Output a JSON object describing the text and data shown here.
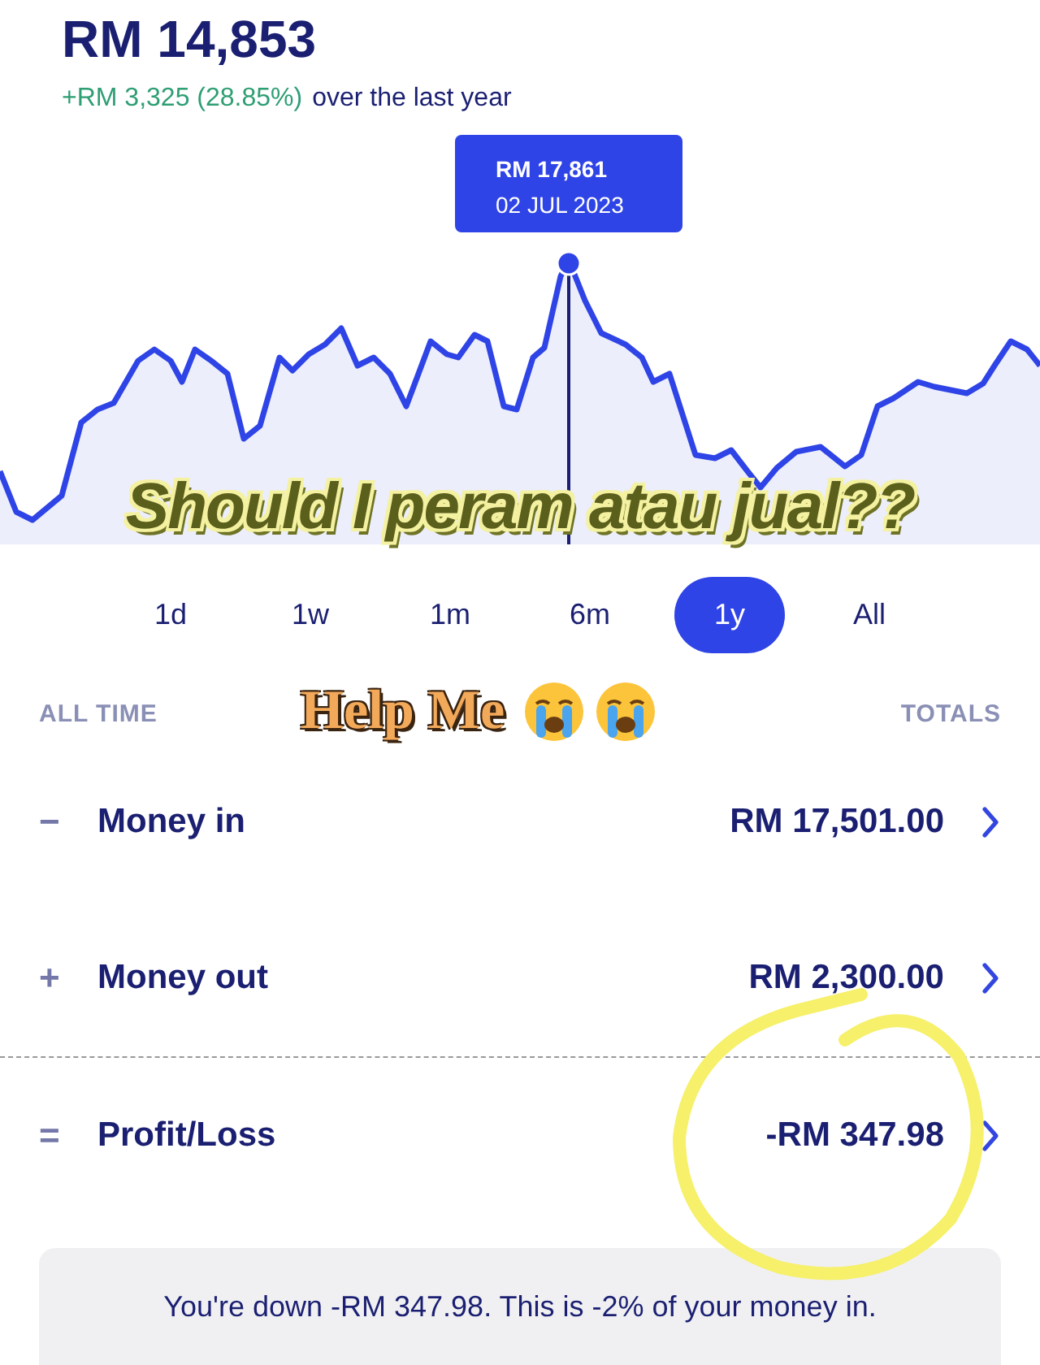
{
  "balance": {
    "amount": "RM 14,853",
    "change": "+RM 3,325 (28.85%)",
    "period": "over the last year"
  },
  "chart": {
    "tooltip": {
      "value": "RM 17,861",
      "date": "02 JUL 2023"
    }
  },
  "ranges": [
    {
      "label": "1d",
      "selected": false
    },
    {
      "label": "1w",
      "selected": false
    },
    {
      "label": "1m",
      "selected": false
    },
    {
      "label": "6m",
      "selected": false
    },
    {
      "label": "1y",
      "selected": true
    },
    {
      "label": "All",
      "selected": false
    }
  ],
  "summary": {
    "left_label": "ALL TIME",
    "right_label": "TOTALS",
    "rows": [
      {
        "kind": "entry",
        "sign": "−",
        "label": "Money in",
        "value": "RM 17,501.00"
      },
      {
        "kind": "entry",
        "sign": "+",
        "label": "Money out",
        "value": "RM 2,300.00"
      },
      {
        "kind": "total",
        "sign": "=",
        "label": "Profit/Loss",
        "value": "-RM 347.98"
      }
    ]
  },
  "note": "You're down -RM 347.98. This is -2% of your money in.",
  "overlays": {
    "caption": "Should I peram atau jual??",
    "plea": "Help Me"
  }
}
